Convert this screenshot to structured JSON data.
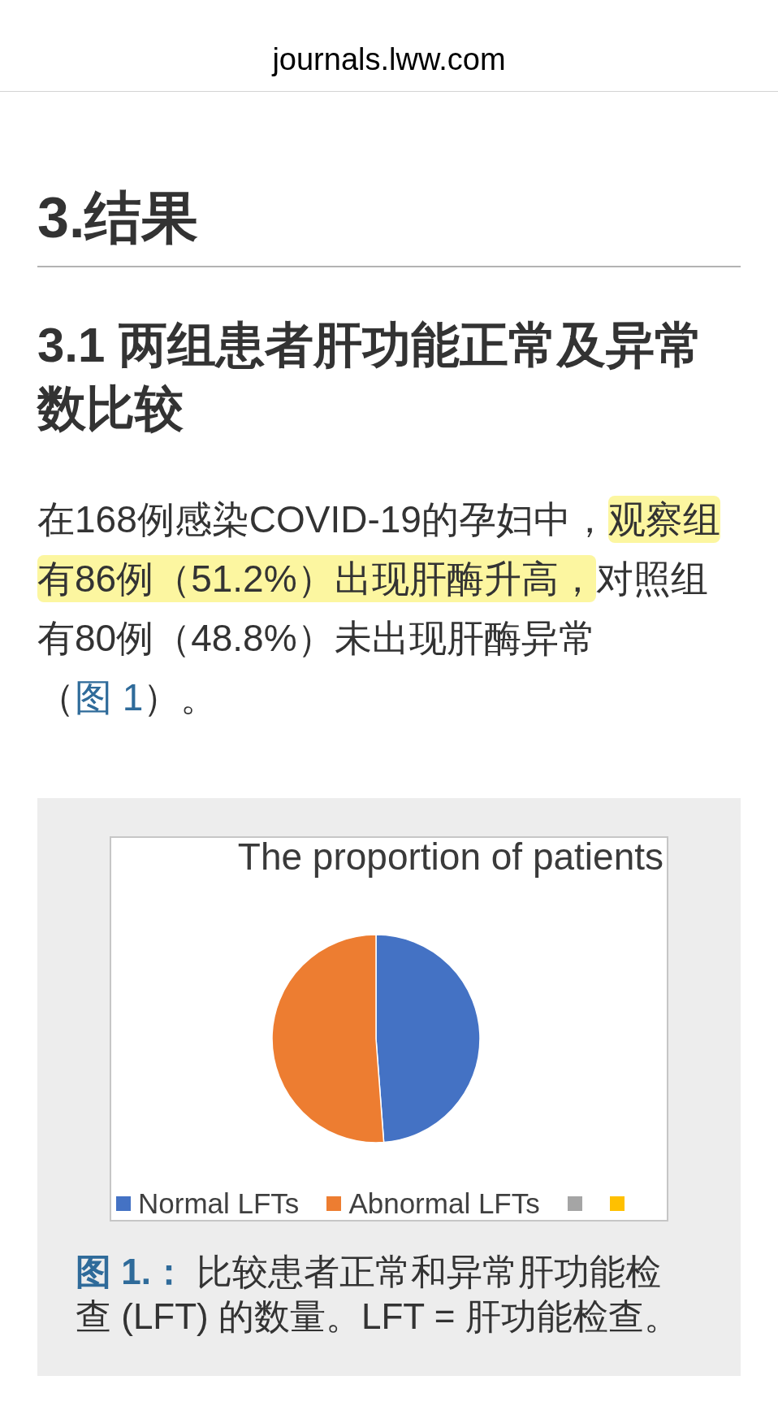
{
  "browser_bar": {
    "url": "journals.lww.com"
  },
  "section_heading": "3.结果",
  "subsection_heading": "3.1 两组患者肝功能正常及异常数比较",
  "paragraph": {
    "segments": [
      {
        "text": "在168例感染COVID-19的孕妇中，",
        "kind": "plain"
      },
      {
        "text": "观察组有86例（51.2%）出现肝酶升高，",
        "kind": "highlight"
      },
      {
        "text": "对照组有80例（48.8%）未出现肝酶异常（",
        "kind": "plain"
      },
      {
        "text": "图 1",
        "kind": "link"
      },
      {
        "text": "）。",
        "kind": "plain"
      }
    ]
  },
  "figure": {
    "chart": {
      "title": "The proportion of patients",
      "legend": [
        {
          "label": "Normal LFTs",
          "color": "#4472c4"
        },
        {
          "label": "Abnormal LFTs",
          "color": "#ed7d31"
        },
        {
          "color": "#a5a5a5"
        },
        {
          "color": "#ffc000"
        }
      ]
    },
    "caption": {
      "label": "图 1.：",
      "text": "比较患者正常和异常肝功能检查 (LFT) 的数量。LFT = 肝功能检查。"
    }
  }
}
